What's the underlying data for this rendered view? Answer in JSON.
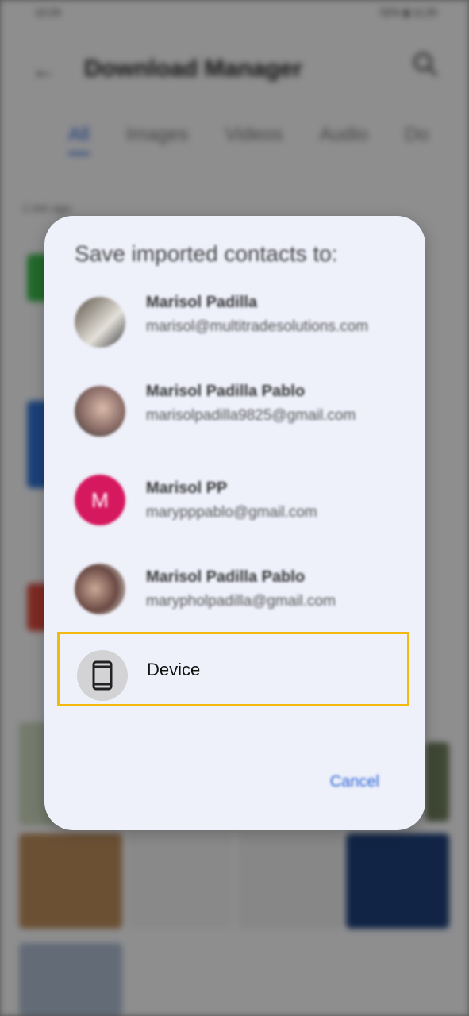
{
  "background": {
    "status_left": "12:24",
    "status_right": "52% ▮ 11:25",
    "title": "Download Manager",
    "tabs": [
      "All",
      "Images",
      "Videos",
      "Audio",
      "Do"
    ],
    "section_label": "1 min ago"
  },
  "dialog": {
    "title": "Save imported contacts to:",
    "accounts": [
      {
        "name": "Marisol Padilla",
        "email": "marisol@multitradesolutions.com",
        "avatar": "photo"
      },
      {
        "name": "Marisol Padilla Pablo",
        "email": "marisolpadilla9825@gmail.com",
        "avatar": "photo"
      },
      {
        "name": "Marisol PP",
        "email": "marypppablo@gmail.com",
        "avatar": "initial",
        "initial": "M",
        "color": "#d6185e"
      },
      {
        "name": "Marisol Padilla Pablo",
        "email": "marypholpadilla@gmail.com",
        "avatar": "photo"
      }
    ],
    "device": {
      "label": "Device",
      "icon": "phone-icon"
    },
    "cancel_label": "Cancel"
  },
  "colors": {
    "highlight": "#f3b90c",
    "accent": "#2a63d6"
  }
}
